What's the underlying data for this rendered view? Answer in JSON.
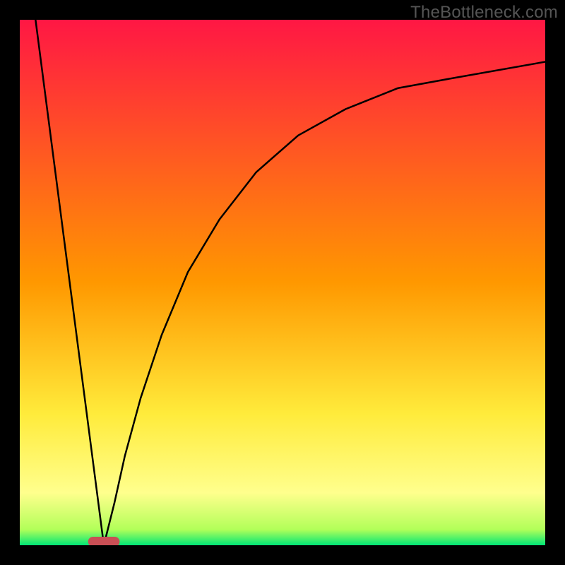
{
  "watermark": "TheBottleneck.com",
  "chart_data": {
    "type": "line",
    "title": "",
    "xlabel": "",
    "ylabel": "",
    "xlim": [
      0,
      100
    ],
    "ylim": [
      0,
      100
    ],
    "grid": false,
    "legend": false,
    "background_gradient": {
      "stops": [
        {
          "offset": 0.0,
          "color": "#ff1744"
        },
        {
          "offset": 0.5,
          "color": "#ff9800"
        },
        {
          "offset": 0.75,
          "color": "#ffeb3b"
        },
        {
          "offset": 0.9,
          "color": "#ffff8d"
        },
        {
          "offset": 0.97,
          "color": "#b2ff59"
        },
        {
          "offset": 1.0,
          "color": "#00e676"
        }
      ]
    },
    "series": [
      {
        "name": "left-line",
        "color": "#000000",
        "x": [
          3,
          16
        ],
        "y": [
          100,
          0
        ]
      },
      {
        "name": "right-curve",
        "color": "#000000",
        "x": [
          16,
          18,
          20,
          23,
          27,
          32,
          38,
          45,
          53,
          62,
          72,
          83,
          100
        ],
        "y": [
          0,
          8,
          17,
          28,
          40,
          52,
          62,
          71,
          78,
          83,
          87,
          89,
          92
        ]
      }
    ],
    "marker": {
      "name": "bottom-pill",
      "x_center": 16,
      "width": 6,
      "color": "#c94f55"
    }
  }
}
